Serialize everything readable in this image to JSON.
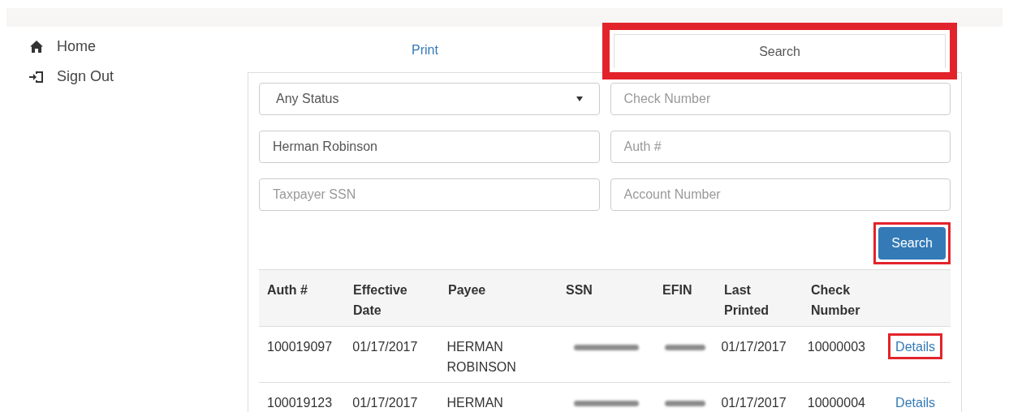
{
  "sidebar": {
    "items": [
      {
        "kind": "home",
        "label": "Home"
      },
      {
        "kind": "signout",
        "label": "Sign Out"
      }
    ]
  },
  "tabs": [
    {
      "label": "Print",
      "selected": false,
      "highlighted": false
    },
    {
      "label": "Search",
      "selected": true,
      "highlighted": true
    }
  ],
  "form": {
    "status_select": {
      "value": "Any Status"
    },
    "fields": [
      {
        "placeholder": "Check Number"
      },
      {
        "value": "Herman Robinson"
      },
      {
        "placeholder": "Auth #"
      },
      {
        "placeholder": "Taxpayer SSN"
      },
      {
        "placeholder": "Account Number"
      }
    ],
    "search_button": {
      "label": "Search",
      "highlighted": true
    }
  },
  "table": {
    "columns": [
      "Auth #",
      "Effective Date",
      "Payee",
      "SSN",
      "EFIN",
      "Last Printed",
      "Check Number"
    ],
    "rows": [
      {
        "auth": "100019097",
        "effective_date": "01/17/2017",
        "payee": "HERMAN ROBINSON",
        "ssn_redacted": true,
        "efin_redacted": true,
        "last_printed": "01/17/2017",
        "check_number": "10000003",
        "link": "Details",
        "highlighted": true
      },
      {
        "auth": "100019123",
        "effective_date": "01/17/2017",
        "payee": "HERMAN",
        "ssn_redacted": true,
        "efin_redacted": true,
        "last_printed": "01/17/2017",
        "check_number": "10000004",
        "link": "Details",
        "highlighted": false
      }
    ]
  }
}
